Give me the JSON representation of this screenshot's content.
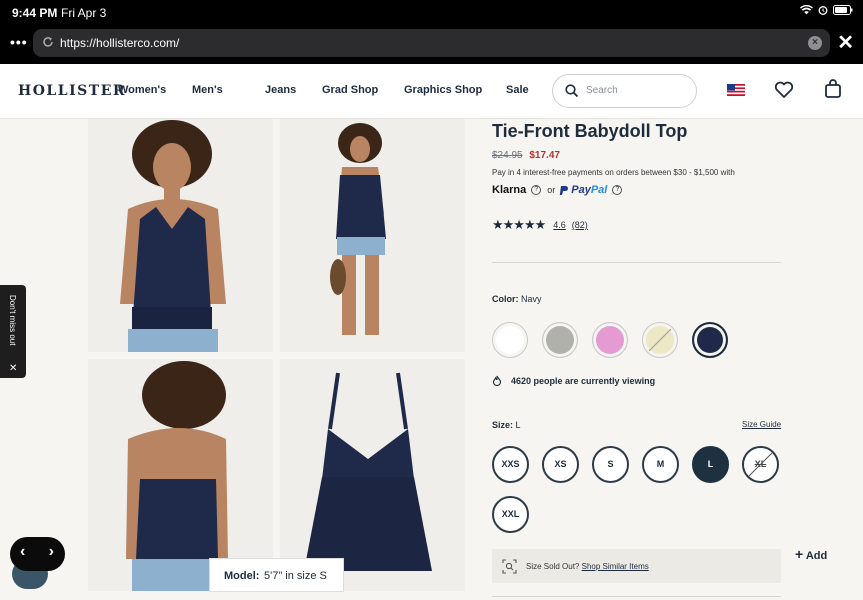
{
  "status": {
    "time": "9:44 PM",
    "date": "Fri Apr 3"
  },
  "browser": {
    "url": "https://hollisterco.com/"
  },
  "nav": {
    "logo": "HOLLISTER",
    "links": [
      "Women's",
      "Men's",
      "Jeans",
      "Grad Shop",
      "Graphics Shop",
      "Sale"
    ],
    "search_placeholder": "Search"
  },
  "sidetab": {
    "label": "Don't miss out"
  },
  "model_tag": {
    "key": "Model:",
    "value": "5'7\" in size S"
  },
  "product": {
    "title": "Tie-Front Babydoll Top",
    "old_price": "$24.95",
    "new_price": "$17.47",
    "pay_in": "Pay in 4 interest-free payments on orders between $30 - $1,500 with",
    "klarna": "Klarna",
    "or": "or",
    "paypal_a": "Pay",
    "paypal_b": "Pal",
    "rating_value": "4.6",
    "rating_count": "(82)",
    "rating_stars": 4.6,
    "color_label": "Color:",
    "color_value": "Navy",
    "swatches": [
      {
        "name": "White",
        "color": "#ffffff",
        "sold_out": false,
        "selected": false
      },
      {
        "name": "Grey",
        "color": "#b1b1ac",
        "sold_out": false,
        "selected": false
      },
      {
        "name": "Pink",
        "color": "#e59ad2",
        "sold_out": false,
        "selected": false
      },
      {
        "name": "Cream",
        "color": "#ece7c5",
        "sold_out": true,
        "selected": false
      },
      {
        "name": "Navy",
        "color": "#1f2a4a",
        "sold_out": false,
        "selected": true
      }
    ],
    "viewing": "4620 people are currently viewing",
    "size_label": "Size:",
    "size_value": "L",
    "size_guide": "Size Guide",
    "sizes": [
      {
        "label": "XXS",
        "selected": false,
        "sold_out": false
      },
      {
        "label": "XS",
        "selected": false,
        "sold_out": false
      },
      {
        "label": "S",
        "selected": false,
        "sold_out": false
      },
      {
        "label": "M",
        "selected": false,
        "sold_out": false
      },
      {
        "label": "L",
        "selected": true,
        "sold_out": false
      },
      {
        "label": "XL",
        "selected": false,
        "sold_out": true
      },
      {
        "label": "XXL",
        "selected": false,
        "sold_out": false
      }
    ],
    "sold_out_text": "Size Sold Out?",
    "similar_link": "Shop Similar Items",
    "add_label": "Add"
  }
}
